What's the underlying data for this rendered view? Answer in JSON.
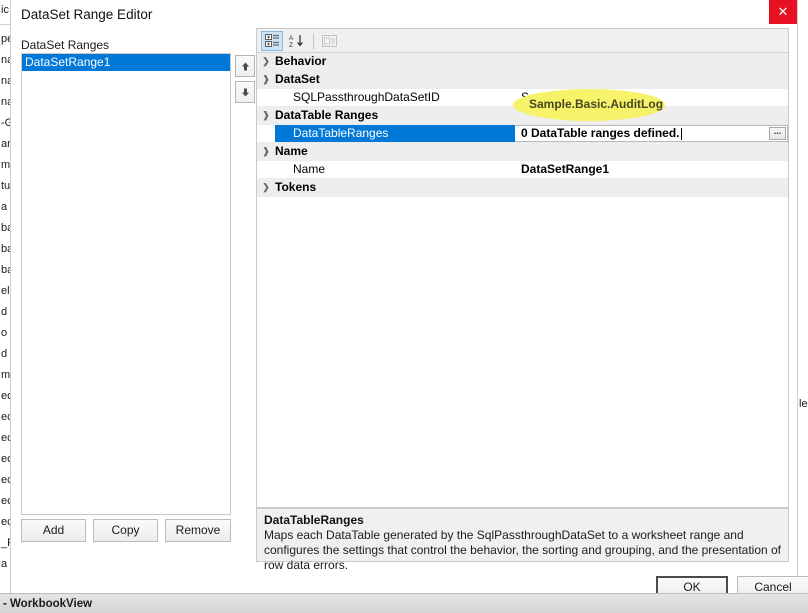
{
  "window": {
    "title": "DataSet Range Editor",
    "close_icon": "close-icon",
    "close_label": "✕"
  },
  "status_bar": {
    "text": "- WorkbookView"
  },
  "background_fragments": {
    "left": [
      "ic",
      "pe",
      "na",
      "na",
      "na",
      "-G",
      "ar",
      "m",
      "tu",
      "a",
      "ba",
      "ba",
      "ba",
      "el",
      "d",
      "o",
      "d",
      "m",
      "ec",
      "ec",
      "ec",
      "ec",
      "ec",
      "ec",
      "ec",
      "_P",
      "a"
    ],
    "right": [
      "le"
    ]
  },
  "left_pane": {
    "label": "DataSet Ranges",
    "items": [
      {
        "label": "DataSetRange1",
        "selected": true
      }
    ],
    "spin_up_icon": "arrow-up-icon",
    "spin_down_icon": "arrow-down-icon",
    "buttons": {
      "add": "Add",
      "copy": "Copy",
      "remove": "Remove"
    }
  },
  "grid": {
    "toolbar": [
      {
        "icon": "categorized-icon",
        "pressed": true,
        "disabled": false
      },
      {
        "icon": "alphabetical-sort-icon",
        "pressed": false,
        "disabled": false
      },
      {
        "icon": "property-pages-icon",
        "pressed": false,
        "disabled": true
      }
    ],
    "rows": [
      {
        "type": "category",
        "chevron": "chevron-right-icon",
        "expanded": false,
        "name": "Behavior",
        "value": ""
      },
      {
        "type": "category",
        "chevron": "chevron-down-icon",
        "expanded": true,
        "name": "DataSet",
        "value": ""
      },
      {
        "type": "property",
        "name": "SQLPassthroughDataSetID",
        "value": "Sample.Basic.AuditLog",
        "selected": false,
        "editing": false,
        "highlighted": true
      },
      {
        "type": "category",
        "chevron": "chevron-down-icon",
        "expanded": true,
        "name": "DataTable Ranges",
        "value": ""
      },
      {
        "type": "property",
        "name": "DataTableRanges",
        "value": "0 DataTable ranges defined.",
        "selected": true,
        "editing": true,
        "highlighted": false,
        "ellipsis_label": "..."
      },
      {
        "type": "category",
        "chevron": "chevron-down-icon",
        "expanded": true,
        "name": "Name",
        "value": ""
      },
      {
        "type": "property",
        "name": "Name",
        "value": "DataSetRange1",
        "selected": false,
        "editing": false,
        "highlighted": false
      },
      {
        "type": "category",
        "chevron": "chevron-right-icon",
        "expanded": false,
        "name": "Tokens",
        "value": ""
      }
    ]
  },
  "description": {
    "title": "DataTableRanges",
    "body": "Maps each DataTable generated by the SqlPassthroughDataSet to a worksheet range and configures the settings that control the behavior, the sorting and grouping, and the presentation of row data errors."
  },
  "dialog_buttons": {
    "ok": "OK",
    "cancel": "Cancel"
  },
  "colors": {
    "selection_blue": "#0078d7",
    "highlight_yellow": "#f6f36a",
    "close_red": "#e81123",
    "category_gray": "#eeeeee"
  }
}
